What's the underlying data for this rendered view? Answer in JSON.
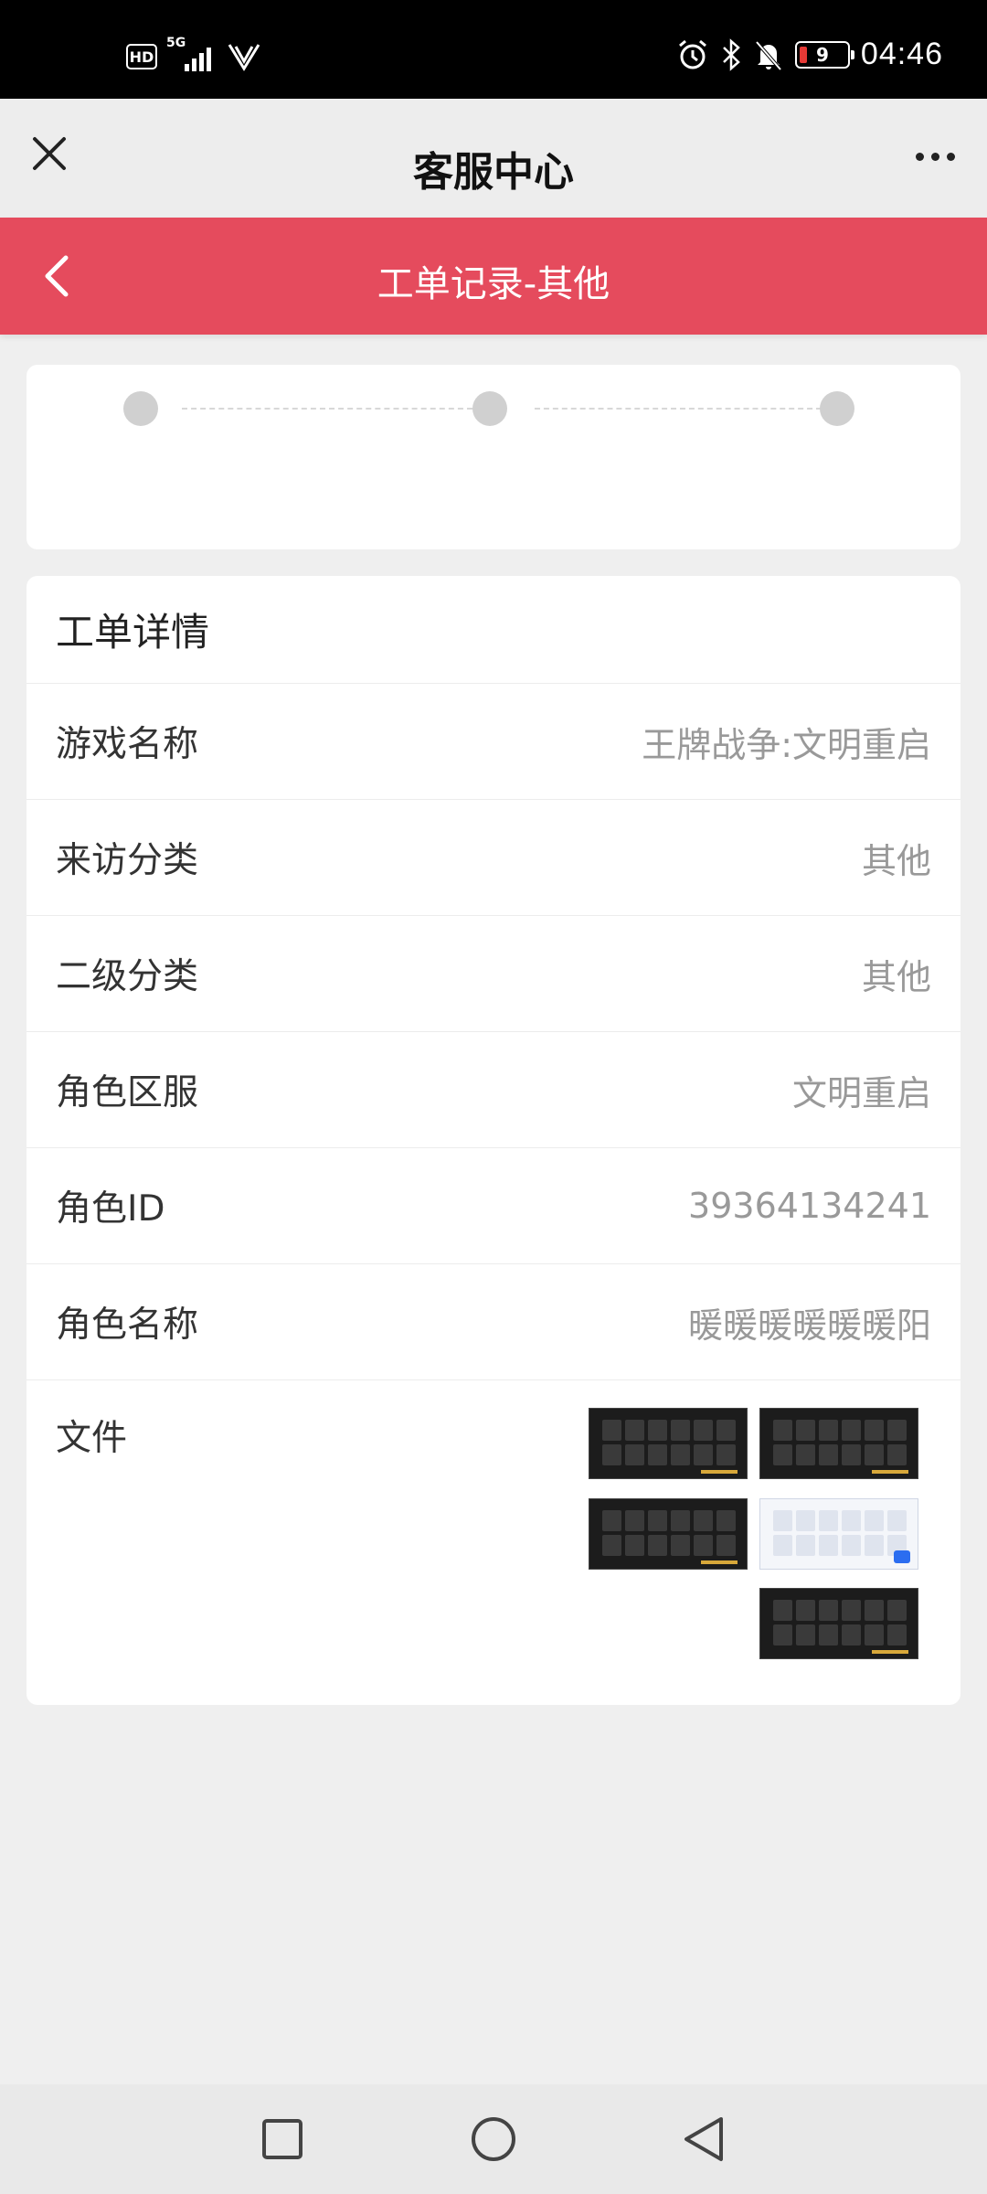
{
  "status_bar": {
    "hd": "HD",
    "network": "5G",
    "battery": "9",
    "time": "04:46"
  },
  "app_bar": {
    "title": "客服中心"
  },
  "header": {
    "title": "工单记录-其他",
    "color": "#e54b5d"
  },
  "progress": {
    "steps": 3
  },
  "detail": {
    "section_title": "工单详情",
    "rows": [
      {
        "label": "游戏名称",
        "value": "王牌战争:文明重启"
      },
      {
        "label": "来访分类",
        "value": "其他"
      },
      {
        "label": "二级分类",
        "value": "其他"
      },
      {
        "label": "角色区服",
        "value": "文明重启"
      },
      {
        "label": "角色ID",
        "value": "39364134241"
      },
      {
        "label": "角色名称",
        "value": "暖暖暖暖暖暖阳"
      }
    ],
    "files_label": "文件",
    "file_count": 5
  }
}
